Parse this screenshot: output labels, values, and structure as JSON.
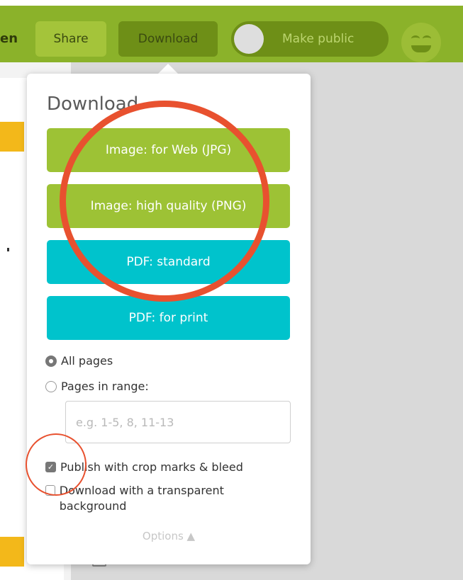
{
  "toolbar": {
    "left_text": "en",
    "share_label": "Share",
    "download_label": "Download",
    "make_public_label": "Make public"
  },
  "popup": {
    "title": "Download",
    "buttons": [
      {
        "label": "Image: for Web (JPG)",
        "color": "#9dc235"
      },
      {
        "label": "Image: high quality (PNG)",
        "color": "#9dc235"
      },
      {
        "label": "PDF: standard",
        "color": "#00c3cc"
      },
      {
        "label": "PDF: for print",
        "color": "#00c3cc"
      }
    ],
    "page_options": {
      "all_pages": "All pages",
      "pages_in_range": "Pages in range:",
      "selected": "all_pages",
      "range_placeholder": "e.g. 1-5, 8, 11-13"
    },
    "checkboxes": {
      "crop_marks": {
        "label": "Publish with crop marks & bleed",
        "checked": true
      },
      "transparent": {
        "label": "Download with a transparent background",
        "checked": false
      }
    },
    "options_label": "Options ▲"
  },
  "colors": {
    "toolbar": "#8bb22a",
    "annotation": "#e8512f"
  }
}
